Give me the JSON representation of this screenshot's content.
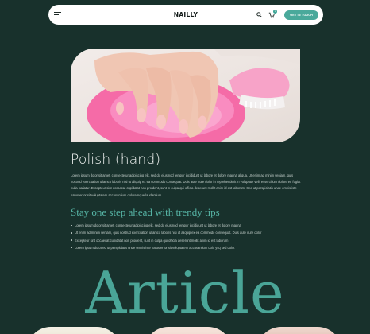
{
  "nav": {
    "logo": "NAILLY",
    "cart_count": "0",
    "cta_label": "GET IN TOUCH"
  },
  "hero": {
    "image_alt": "Hands with pink manicure over pink bowl"
  },
  "article": {
    "title": "Polish (hand)",
    "intro": "Lorem ipsum dolor sit amet, consectetur adipiscing elit, sed do eiusmod tempor incididunt ut labore et dolore magna aliqua. Ut enim ad minim veniam, quis nostrud exercitation ullamco laboris nisi ut aliquip ex ea commodo consequat. Duis aute irure dolor in reprehenderit in voluptate velit esse cillum dolore eu fugiat nulla pariatur. Excepteur sint occaecat cupidatat non proident, sunt in culpa qui officia deserunt mollit anim id est laborum. Sed ut perspiciatis unde omnis iste natus error sit voluptatem accusantium doloremque laudantium.",
    "subtitle": "Stay one step ahead with trendy tips",
    "bullets": [
      "Lorem ipsum dolor sit amet, consectetur adipiscing elit, sed do eiusmod tempor incididunt ut labore et dolore magna",
      "Ut enim ad minim veniam, quis nostrud exercitation ullamco laboris nisi ut aliquip ex ea commodo consequat. Duis aute irure dolor",
      "Excepteur sint occaecat cupidatat non proident, sunt in culpa qui officia deserunt mollit anim id est laborum",
      "Lorem ipsum doloSed ut perspiciatis unde omnis iste natus error sit voluptatem accusantium dolo ysq sed dolot"
    ]
  },
  "section": {
    "heading": "Article"
  },
  "colors": {
    "background": "#18312c",
    "accent": "#4aa99b",
    "nail_pink": "#f2b8b6",
    "bowl_pink": "#f56ba7"
  }
}
